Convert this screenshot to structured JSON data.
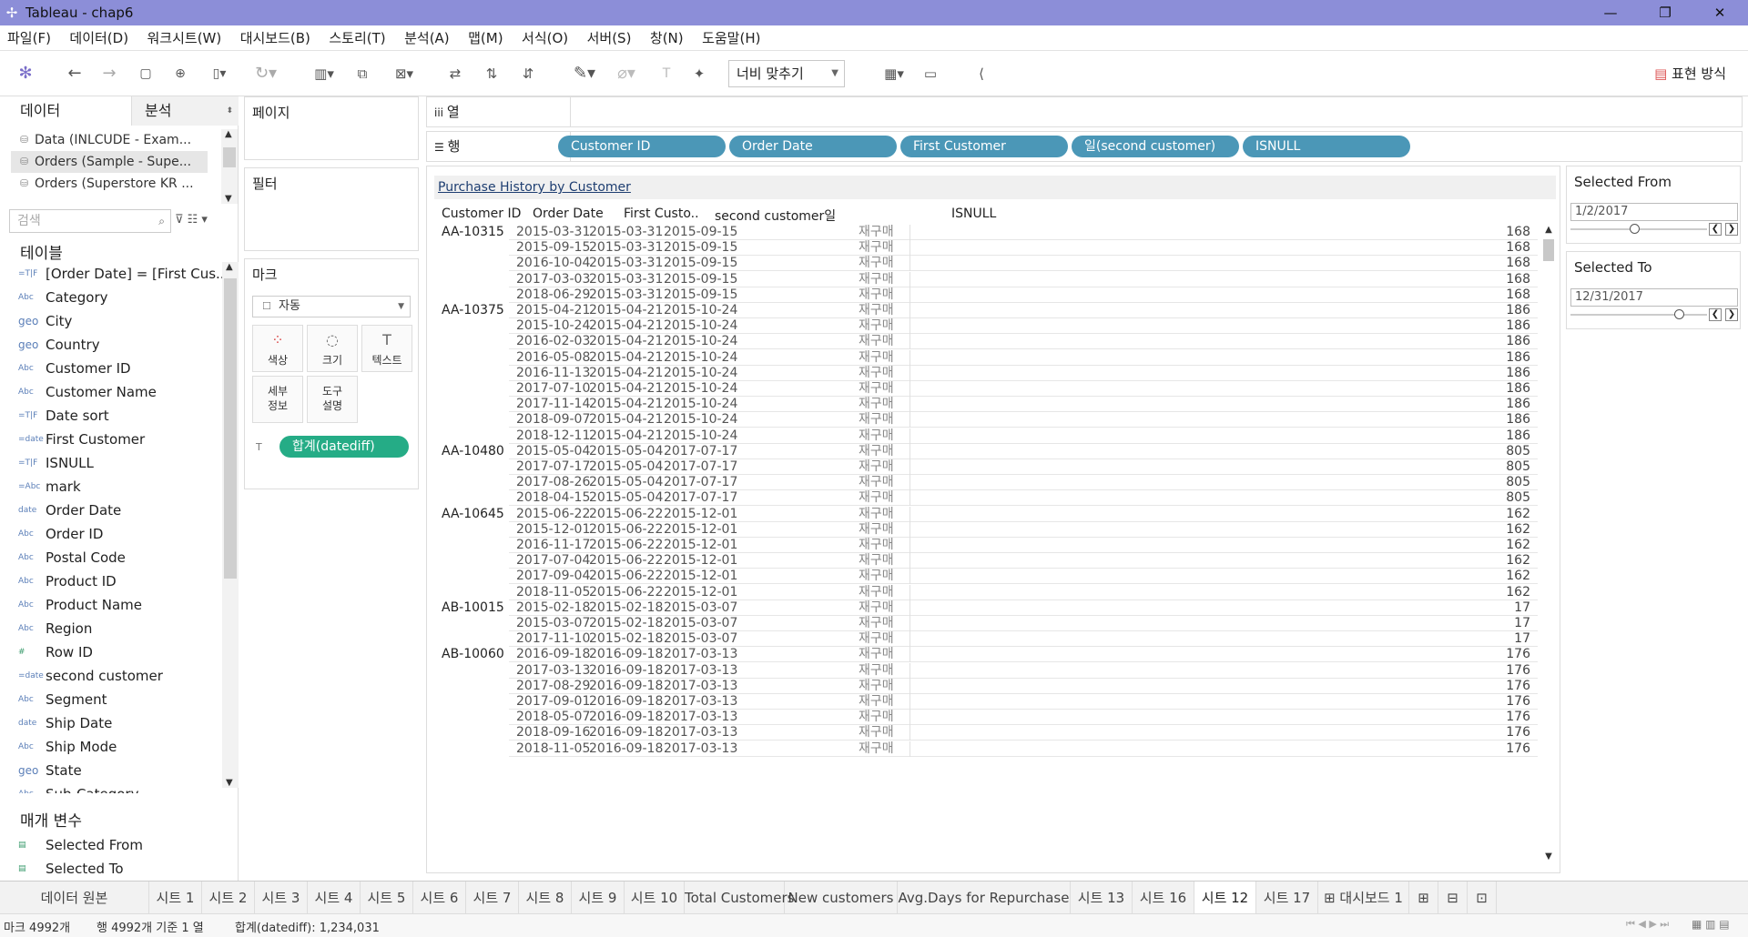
{
  "window": {
    "title": "Tableau - chap6",
    "minimize": "—",
    "restore": "❐",
    "close": "✕"
  },
  "menu": [
    "파일(F)",
    "데이터(D)",
    "워크시트(W)",
    "대시보드(B)",
    "스토리(T)",
    "분석(A)",
    "맵(M)",
    "서식(O)",
    "서버(S)",
    "창(N)",
    "도움말(H)"
  ],
  "toolbar": {
    "fit_label": "너비 맞추기",
    "show_me": "표현 방식"
  },
  "left_pane": {
    "tab_data": "데이터",
    "tab_analysis": "분석",
    "sources": [
      "Data (INLCUDE - Exam...",
      "Orders (Sample - Supe...",
      "Orders (Superstore KR ..."
    ],
    "search_placeholder": "검색",
    "tables_heading": "테이블",
    "fields": [
      {
        "type": "=T|F",
        "name": "[Order Date] = [First Cus..."
      },
      {
        "type": "Abc",
        "name": "Category"
      },
      {
        "type": "geo",
        "name": "City"
      },
      {
        "type": "geo",
        "name": "Country"
      },
      {
        "type": "Abc",
        "name": "Customer ID"
      },
      {
        "type": "Abc",
        "name": "Customer Name"
      },
      {
        "type": "=T|F",
        "name": "Date sort"
      },
      {
        "type": "=date",
        "name": "First Customer"
      },
      {
        "type": "=T|F",
        "name": "ISNULL"
      },
      {
        "type": "=Abc",
        "name": "mark"
      },
      {
        "type": "date",
        "name": "Order Date"
      },
      {
        "type": "Abc",
        "name": "Order ID"
      },
      {
        "type": "Abc",
        "name": "Postal Code"
      },
      {
        "type": "Abc",
        "name": "Product ID"
      },
      {
        "type": "Abc",
        "name": "Product Name"
      },
      {
        "type": "Abc",
        "name": "Region"
      },
      {
        "type": "#",
        "name": "Row ID"
      },
      {
        "type": "=date",
        "name": "second customer"
      },
      {
        "type": "Abc",
        "name": "Segment"
      },
      {
        "type": "date",
        "name": "Ship Date"
      },
      {
        "type": "Abc",
        "name": "Ship Mode"
      },
      {
        "type": "geo",
        "name": "State"
      },
      {
        "type": "Abc",
        "name": "Sub-Category"
      }
    ],
    "params_heading": "매개 변수",
    "params": [
      "Selected From",
      "Selected To"
    ]
  },
  "cards": {
    "pages": "페이지",
    "filters": "필터",
    "marks": "마크",
    "mark_type": "자동",
    "mark_buttons": [
      {
        "icon": "⁘",
        "label": "색상"
      },
      {
        "icon": "◌",
        "label": "크기"
      },
      {
        "icon": "T",
        "label": "텍스트"
      },
      {
        "icon": "",
        "label": "세부\n정보"
      },
      {
        "icon": "",
        "label": "도구\n설명"
      }
    ],
    "mark_pill": "합계(datediff)"
  },
  "shelves": {
    "columns_label": "열",
    "rows_label": "행",
    "rows_pills": [
      "Customer ID",
      "Order Date",
      "First Customer",
      "일(second customer)",
      "ISNULL"
    ]
  },
  "view": {
    "title": "Purchase History by Customer",
    "headers": [
      "Customer ID",
      "Order Date",
      "First Custo..",
      "second customer일",
      "ISNULL"
    ],
    "rows": [
      [
        "AA-10315",
        "2015-03-31",
        "2015-03-31",
        "2015-09-15",
        "재구매",
        "168"
      ],
      [
        "",
        "2015-09-15",
        "2015-03-31",
        "2015-09-15",
        "재구매",
        "168"
      ],
      [
        "",
        "2016-10-04",
        "2015-03-31",
        "2015-09-15",
        "재구매",
        "168"
      ],
      [
        "",
        "2017-03-03",
        "2015-03-31",
        "2015-09-15",
        "재구매",
        "168"
      ],
      [
        "",
        "2018-06-29",
        "2015-03-31",
        "2015-09-15",
        "재구매",
        "168"
      ],
      [
        "AA-10375",
        "2015-04-21",
        "2015-04-21",
        "2015-10-24",
        "재구매",
        "186"
      ],
      [
        "",
        "2015-10-24",
        "2015-04-21",
        "2015-10-24",
        "재구매",
        "186"
      ],
      [
        "",
        "2016-02-03",
        "2015-04-21",
        "2015-10-24",
        "재구매",
        "186"
      ],
      [
        "",
        "2016-05-08",
        "2015-04-21",
        "2015-10-24",
        "재구매",
        "186"
      ],
      [
        "",
        "2016-11-13",
        "2015-04-21",
        "2015-10-24",
        "재구매",
        "186"
      ],
      [
        "",
        "2017-07-10",
        "2015-04-21",
        "2015-10-24",
        "재구매",
        "186"
      ],
      [
        "",
        "2017-11-14",
        "2015-04-21",
        "2015-10-24",
        "재구매",
        "186"
      ],
      [
        "",
        "2018-09-07",
        "2015-04-21",
        "2015-10-24",
        "재구매",
        "186"
      ],
      [
        "",
        "2018-12-11",
        "2015-04-21",
        "2015-10-24",
        "재구매",
        "186"
      ],
      [
        "AA-10480",
        "2015-05-04",
        "2015-05-04",
        "2017-07-17",
        "재구매",
        "805"
      ],
      [
        "",
        "2017-07-17",
        "2015-05-04",
        "2017-07-17",
        "재구매",
        "805"
      ],
      [
        "",
        "2017-08-26",
        "2015-05-04",
        "2017-07-17",
        "재구매",
        "805"
      ],
      [
        "",
        "2018-04-15",
        "2015-05-04",
        "2017-07-17",
        "재구매",
        "805"
      ],
      [
        "AA-10645",
        "2015-06-22",
        "2015-06-22",
        "2015-12-01",
        "재구매",
        "162"
      ],
      [
        "",
        "2015-12-01",
        "2015-06-22",
        "2015-12-01",
        "재구매",
        "162"
      ],
      [
        "",
        "2016-11-17",
        "2015-06-22",
        "2015-12-01",
        "재구매",
        "162"
      ],
      [
        "",
        "2017-07-04",
        "2015-06-22",
        "2015-12-01",
        "재구매",
        "162"
      ],
      [
        "",
        "2017-09-04",
        "2015-06-22",
        "2015-12-01",
        "재구매",
        "162"
      ],
      [
        "",
        "2018-11-05",
        "2015-06-22",
        "2015-12-01",
        "재구매",
        "162"
      ],
      [
        "AB-10015",
        "2015-02-18",
        "2015-02-18",
        "2015-03-07",
        "재구매",
        "17"
      ],
      [
        "",
        "2015-03-07",
        "2015-02-18",
        "2015-03-07",
        "재구매",
        "17"
      ],
      [
        "",
        "2017-11-10",
        "2015-02-18",
        "2015-03-07",
        "재구매",
        "17"
      ],
      [
        "AB-10060",
        "2016-09-18",
        "2016-09-18",
        "2017-03-13",
        "재구매",
        "176"
      ],
      [
        "",
        "2017-03-13",
        "2016-09-18",
        "2017-03-13",
        "재구매",
        "176"
      ],
      [
        "",
        "2017-08-29",
        "2016-09-18",
        "2017-03-13",
        "재구매",
        "176"
      ],
      [
        "",
        "2017-09-01",
        "2016-09-18",
        "2017-03-13",
        "재구매",
        "176"
      ],
      [
        "",
        "2018-05-07",
        "2016-09-18",
        "2017-03-13",
        "재구매",
        "176"
      ],
      [
        "",
        "2018-09-16",
        "2016-09-18",
        "2017-03-13",
        "재구매",
        "176"
      ],
      [
        "",
        "2018-11-05",
        "2016-09-18",
        "2017-03-13",
        "재구매",
        "176"
      ]
    ]
  },
  "parameters": {
    "from": {
      "label": "Selected From",
      "value": "1/2/2017",
      "position": 0.45
    },
    "to": {
      "label": "Selected To",
      "value": "12/31/2017",
      "position": 0.79
    }
  },
  "tabs": [
    "데이터 원본",
    "시트 1",
    "시트 2",
    "시트 3",
    "시트 4",
    "시트 5",
    "시트 6",
    "시트 7",
    "시트 8",
    "시트 9",
    "시트 10",
    "Total Customers",
    "New customers",
    "Avg.Days for Repurchase",
    "시트 13",
    "시트 16",
    "시트 12",
    "시트 17",
    "⊞ 대시보드 1"
  ],
  "active_tab": "시트 12",
  "status": {
    "marks": "마크 4992개",
    "rows": "행 4992개 기준 1 열",
    "sum": "합계(datediff): 1,234,031"
  }
}
